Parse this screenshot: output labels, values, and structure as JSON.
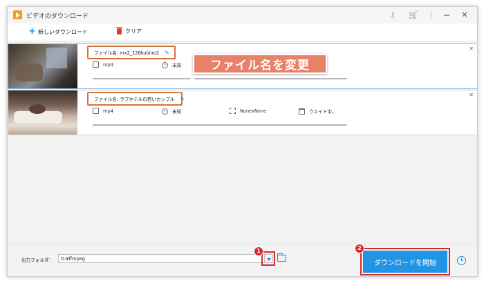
{
  "window": {
    "title": "ビデオのダウンロード"
  },
  "toolbar": {
    "new_download_label": "新しいダウンロード",
    "clear_label": "クリア"
  },
  "downloads": [
    {
      "filename_label": "ファイル名: mx2_126kubiiro2",
      "format": "mp4",
      "duration": "未知",
      "resolution": "",
      "status": ""
    },
    {
      "filename_label": "ファイル名: ラブホテルの若いカップル",
      "format": "mp4",
      "duration": "未知",
      "resolution": "NonexNone",
      "status": "ウエイト中。"
    }
  ],
  "callout": {
    "text": "ファイル名を変更"
  },
  "bottom": {
    "output_folder_label": "出力フォルダ：",
    "output_path": "D:¥ffmpeg",
    "start_label": "ダウンロードを開始",
    "step1": "1",
    "step2": "2"
  },
  "colors": {
    "accent": "#2294e6",
    "annotation_orange": "#d4733c",
    "annotation_red": "#d32b2b",
    "callout_bg": "#e98068"
  },
  "icons": [
    "app-icon",
    "key-icon",
    "cart-icon",
    "minimize-icon",
    "close-icon",
    "plus-icon",
    "trash-icon",
    "pencil-icon",
    "video-format-icon",
    "clock-icon",
    "resolution-icon",
    "folder-status-icon",
    "dropdown-arrow-icon",
    "folder-icon",
    "alarm-clock-icon"
  ]
}
